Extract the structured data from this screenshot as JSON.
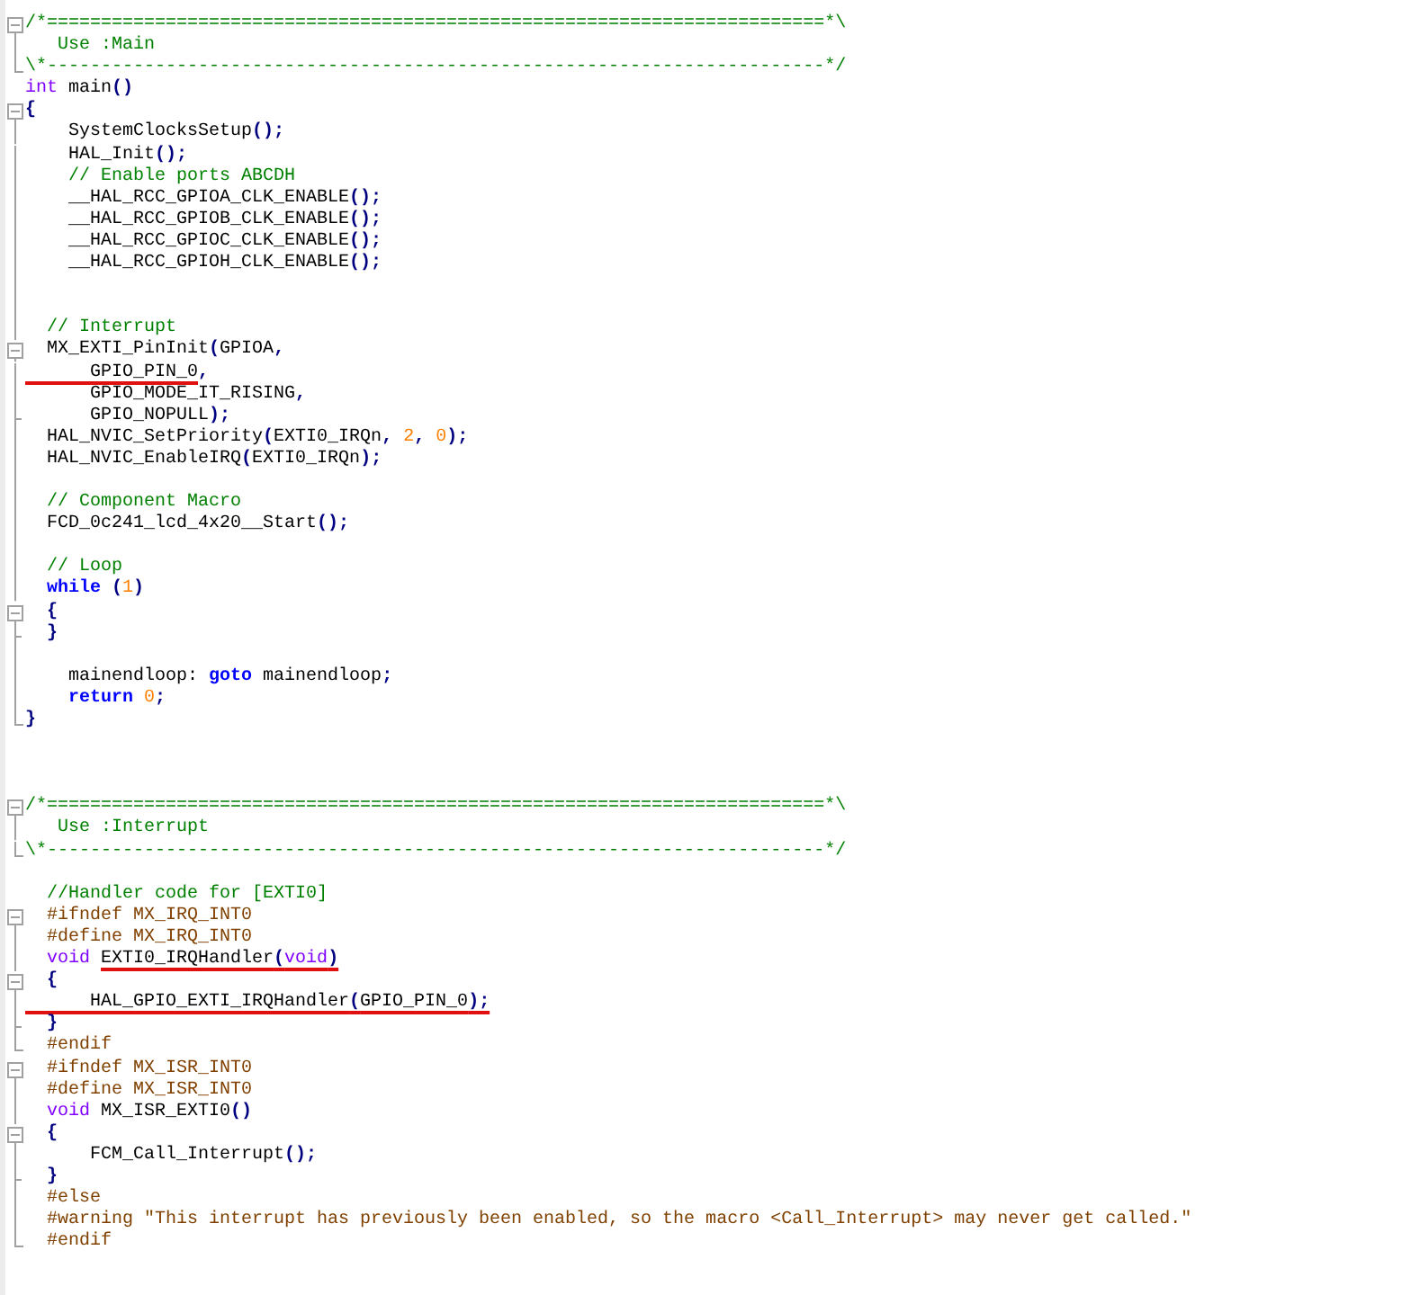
{
  "editor": {
    "lines": [
      {
        "kind": "box",
        "tokens": [
          {
            "kind": "comment",
            "text": "/*========================================================================*\\"
          }
        ]
      },
      {
        "kind": "line",
        "tokens": [
          {
            "kind": "comment",
            "text": "   Use :Main"
          }
        ]
      },
      {
        "kind": "end",
        "tokens": [
          {
            "kind": "comment",
            "text": "\\*------------------------------------------------------------------------*/"
          }
        ]
      },
      {
        "kind": "none",
        "tokens": [
          {
            "kind": "type",
            "text": "int"
          },
          {
            "kind": "plain",
            "text": " main"
          },
          {
            "kind": "op",
            "text": "()"
          }
        ]
      },
      {
        "kind": "box",
        "tokens": [
          {
            "kind": "op",
            "text": "{"
          }
        ]
      },
      {
        "kind": "line",
        "tokens": [
          {
            "kind": "plain",
            "text": "    SystemClocksSetup"
          },
          {
            "kind": "op",
            "text": "();"
          }
        ]
      },
      {
        "kind": "line",
        "tokens": [
          {
            "kind": "plain",
            "text": "    HAL_Init"
          },
          {
            "kind": "op",
            "text": "();"
          }
        ]
      },
      {
        "kind": "line",
        "tokens": [
          {
            "kind": "comment",
            "text": "    // Enable ports ABCDH"
          }
        ]
      },
      {
        "kind": "line",
        "tokens": [
          {
            "kind": "plain",
            "text": "    __HAL_RCC_GPIOA_CLK_ENABLE"
          },
          {
            "kind": "op",
            "text": "();"
          }
        ]
      },
      {
        "kind": "line",
        "tokens": [
          {
            "kind": "plain",
            "text": "    __HAL_RCC_GPIOB_CLK_ENABLE"
          },
          {
            "kind": "op",
            "text": "();"
          }
        ]
      },
      {
        "kind": "line",
        "tokens": [
          {
            "kind": "plain",
            "text": "    __HAL_RCC_GPIOC_CLK_ENABLE"
          },
          {
            "kind": "op",
            "text": "();"
          }
        ]
      },
      {
        "kind": "line",
        "tokens": [
          {
            "kind": "plain",
            "text": "    __HAL_RCC_GPIOH_CLK_ENABLE"
          },
          {
            "kind": "op",
            "text": "();"
          }
        ]
      },
      {
        "kind": "line"
      },
      {
        "kind": "line"
      },
      {
        "kind": "line",
        "tokens": [
          {
            "kind": "comment",
            "text": "  // Interrupt"
          }
        ]
      },
      {
        "kind": "box",
        "tokens": [
          {
            "kind": "plain",
            "text": "  MX_EXTI_PinInit"
          },
          {
            "kind": "op",
            "text": "("
          },
          {
            "kind": "plain",
            "text": "GPIOA"
          },
          {
            "kind": "op",
            "text": ","
          }
        ]
      },
      {
        "kind": "line",
        "tokens": [
          {
            "kind": "plain",
            "text": "      GPIO_PIN_0",
            "underlined": true
          },
          {
            "kind": "op",
            "text": ","
          }
        ]
      },
      {
        "kind": "line",
        "tokens": [
          {
            "kind": "plain",
            "text": "      GPIO_MODE_IT_RISING"
          },
          {
            "kind": "op",
            "text": ","
          }
        ]
      },
      {
        "kind": "tick",
        "tokens": [
          {
            "kind": "plain",
            "text": "      GPIO_NOPULL"
          },
          {
            "kind": "op",
            "text": ");"
          }
        ]
      },
      {
        "kind": "line",
        "tokens": [
          {
            "kind": "plain",
            "text": "  HAL_NVIC_SetPriority"
          },
          {
            "kind": "op",
            "text": "("
          },
          {
            "kind": "plain",
            "text": "EXTI0_IRQn"
          },
          {
            "kind": "op",
            "text": ", "
          },
          {
            "kind": "number",
            "text": "2"
          },
          {
            "kind": "op",
            "text": ", "
          },
          {
            "kind": "number",
            "text": "0"
          },
          {
            "kind": "op",
            "text": ");"
          }
        ]
      },
      {
        "kind": "line",
        "tokens": [
          {
            "kind": "plain",
            "text": "  HAL_NVIC_EnableIRQ"
          },
          {
            "kind": "op",
            "text": "("
          },
          {
            "kind": "plain",
            "text": "EXTI0_IRQn"
          },
          {
            "kind": "op",
            "text": ");"
          }
        ]
      },
      {
        "kind": "line"
      },
      {
        "kind": "line",
        "tokens": [
          {
            "kind": "comment",
            "text": "  // Component Macro"
          }
        ]
      },
      {
        "kind": "line",
        "tokens": [
          {
            "kind": "plain",
            "text": "  FCD_0c241_lcd_4x20__Start"
          },
          {
            "kind": "op",
            "text": "();"
          }
        ]
      },
      {
        "kind": "line"
      },
      {
        "kind": "line",
        "tokens": [
          {
            "kind": "comment",
            "text": "  // Loop"
          }
        ]
      },
      {
        "kind": "line",
        "tokens": [
          {
            "kind": "keyword",
            "text": "  while"
          },
          {
            "kind": "op",
            "text": " ("
          },
          {
            "kind": "number",
            "text": "1"
          },
          {
            "kind": "op",
            "text": ")"
          }
        ]
      },
      {
        "kind": "box",
        "tokens": [
          {
            "kind": "op",
            "text": "  {"
          }
        ]
      },
      {
        "kind": "tick",
        "tokens": [
          {
            "kind": "op",
            "text": "  }"
          }
        ]
      },
      {
        "kind": "line"
      },
      {
        "kind": "line",
        "tokens": [
          {
            "kind": "plain",
            "text": "    mainendloop: "
          },
          {
            "kind": "keyword",
            "text": "goto"
          },
          {
            "kind": "plain",
            "text": " mainendloop"
          },
          {
            "kind": "op",
            "text": ";"
          }
        ]
      },
      {
        "kind": "line",
        "tokens": [
          {
            "kind": "keyword",
            "text": "    return"
          },
          {
            "kind": "number",
            "text": " 0"
          },
          {
            "kind": "op",
            "text": ";"
          }
        ]
      },
      {
        "kind": "end",
        "tokens": [
          {
            "kind": "op",
            "text": "}"
          }
        ]
      },
      {
        "kind": "none"
      },
      {
        "kind": "none"
      },
      {
        "kind": "none"
      },
      {
        "kind": "box",
        "tokens": [
          {
            "kind": "comment",
            "text": "/*========================================================================*\\"
          }
        ]
      },
      {
        "kind": "line",
        "tokens": [
          {
            "kind": "comment",
            "text": "   Use :Interrupt"
          }
        ]
      },
      {
        "kind": "end",
        "tokens": [
          {
            "kind": "comment",
            "text": "\\*------------------------------------------------------------------------*/"
          }
        ]
      },
      {
        "kind": "none"
      },
      {
        "kind": "none",
        "tokens": [
          {
            "kind": "comment",
            "text": "  //Handler code for [EXTI0]"
          }
        ]
      },
      {
        "kind": "box",
        "tokens": [
          {
            "kind": "preproc",
            "text": "  #ifndef MX_IRQ_INT0"
          }
        ]
      },
      {
        "kind": "line",
        "tokens": [
          {
            "kind": "preproc",
            "text": "  #define MX_IRQ_INT0"
          }
        ]
      },
      {
        "kind": "line",
        "tokens": [
          {
            "kind": "type",
            "text": "  void "
          },
          {
            "kind": "plain",
            "text": "EXTI0_IRQHandler",
            "underlined": true
          },
          {
            "kind": "op",
            "text": "(",
            "underlined": true
          },
          {
            "kind": "type",
            "text": "void",
            "underlined": true
          },
          {
            "kind": "op",
            "text": ")",
            "underlined": true
          }
        ]
      },
      {
        "kind": "box",
        "tokens": [
          {
            "kind": "op",
            "text": "  {"
          }
        ]
      },
      {
        "kind": "line",
        "tokens": [
          {
            "kind": "plain",
            "text": "      HAL_GPIO_EXTI_IRQHandler",
            "underlined": true
          },
          {
            "kind": "op",
            "text": "(",
            "underlined": true
          },
          {
            "kind": "plain",
            "text": "GPIO_PIN_0",
            "underlined": true
          },
          {
            "kind": "op",
            "text": ");",
            "underlined": true
          }
        ]
      },
      {
        "kind": "tick",
        "tokens": [
          {
            "kind": "op",
            "text": "  }"
          }
        ]
      },
      {
        "kind": "end",
        "tokens": [
          {
            "kind": "preproc",
            "text": "  #endif"
          }
        ]
      },
      {
        "kind": "box",
        "tokens": [
          {
            "kind": "preproc",
            "text": "  #ifndef MX_ISR_INT0"
          }
        ]
      },
      {
        "kind": "line",
        "tokens": [
          {
            "kind": "preproc",
            "text": "  #define MX_ISR_INT0"
          }
        ]
      },
      {
        "kind": "line",
        "tokens": [
          {
            "kind": "type",
            "text": "  void"
          },
          {
            "kind": "plain",
            "text": " MX_ISR_EXTI0"
          },
          {
            "kind": "op",
            "text": "()"
          }
        ]
      },
      {
        "kind": "box",
        "tokens": [
          {
            "kind": "op",
            "text": "  {"
          }
        ]
      },
      {
        "kind": "line",
        "tokens": [
          {
            "kind": "plain",
            "text": "      FCM_Call_Interrupt"
          },
          {
            "kind": "op",
            "text": "();"
          }
        ]
      },
      {
        "kind": "tick",
        "tokens": [
          {
            "kind": "op",
            "text": "  }"
          }
        ]
      },
      {
        "kind": "line",
        "tokens": [
          {
            "kind": "preproc",
            "text": "  #else"
          }
        ]
      },
      {
        "kind": "line",
        "tokens": [
          {
            "kind": "preproc",
            "text": "  #warning \"This interrupt has previously been enabled, so the macro <Call_Interrupt> may never get called.\""
          }
        ]
      },
      {
        "kind": "end",
        "tokens": [
          {
            "kind": "preproc",
            "text": "  #endif"
          }
        ]
      }
    ]
  }
}
